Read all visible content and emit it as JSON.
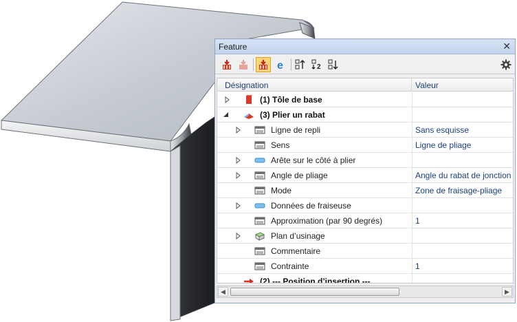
{
  "panel": {
    "title": "Feature",
    "close_glyph": "✕",
    "settings_icon": "gear-icon"
  },
  "toolbar": {
    "buttons": [
      {
        "icon": "feature-insert-icon",
        "active": false
      },
      {
        "icon": "feature-insert-disabled-icon",
        "active": false
      },
      {
        "icon": "feature-insert-active-icon",
        "active": true
      },
      {
        "icon": "e-icon",
        "active": false
      },
      {
        "icon": "sort-ascending-icon",
        "active": false
      },
      {
        "icon": "sort-numbered-icon",
        "active": false
      },
      {
        "icon": "sort-descending-icon",
        "active": false
      }
    ]
  },
  "table": {
    "headers": {
      "designation": "Désignation",
      "valeur": "Valeur"
    },
    "rows": [
      {
        "label": "(1) Tôle de base",
        "value": "",
        "bold": true,
        "level": 0,
        "expander": "collapsed",
        "icon": "sheet-metal-icon"
      },
      {
        "label": "(3) Plier un rabat",
        "value": "",
        "bold": true,
        "level": 0,
        "expander": "expanded",
        "icon": "flange-icon"
      },
      {
        "label": "Ligne de repli",
        "value": "Sans esquisse",
        "bold": false,
        "level": 1,
        "expander": "collapsed",
        "icon": "property-icon"
      },
      {
        "label": "Sens",
        "value": "Ligne de pliage",
        "bold": false,
        "level": 1,
        "expander": "none",
        "icon": "property-icon"
      },
      {
        "label": "Arête sur le côté à plier",
        "value": "",
        "bold": false,
        "level": 1,
        "expander": "collapsed",
        "icon": "edge-icon"
      },
      {
        "label": "Angle de pliage",
        "value": "Angle du rabat de jonction",
        "bold": false,
        "level": 1,
        "expander": "collapsed",
        "icon": "property-icon"
      },
      {
        "label": "Mode",
        "value": "Zone de fraisage-pliage",
        "bold": false,
        "level": 1,
        "expander": "none",
        "icon": "property-icon"
      },
      {
        "label": "Données de fraiseuse",
        "value": "",
        "bold": false,
        "level": 1,
        "expander": "collapsed",
        "icon": "edge-icon"
      },
      {
        "label": "Approximation (par 90 degrés)",
        "value": "1",
        "bold": false,
        "level": 1,
        "expander": "none",
        "icon": "property-icon"
      },
      {
        "label": "Plan d’usinage",
        "value": "",
        "bold": false,
        "level": 1,
        "expander": "collapsed",
        "icon": "plane-icon"
      },
      {
        "label": "Commentaire",
        "value": "",
        "bold": false,
        "level": 1,
        "expander": "none",
        "icon": "property-icon"
      },
      {
        "label": "Contrainte",
        "value": "1",
        "bold": false,
        "level": 1,
        "expander": "none",
        "icon": "property-icon"
      },
      {
        "label": "(2) --- Position  d’insertion ---",
        "value": "",
        "bold": true,
        "level": 0,
        "expander": "none",
        "icon": "red-arrow-icon"
      }
    ]
  },
  "scrollbar": {
    "left_glyph": "◀",
    "right_glyph": "▶",
    "position": 0.0
  },
  "colors": {
    "accent_active": "#fbd77a",
    "value_text": "#1a3f7f",
    "title_bar": "#c9d9ef"
  }
}
